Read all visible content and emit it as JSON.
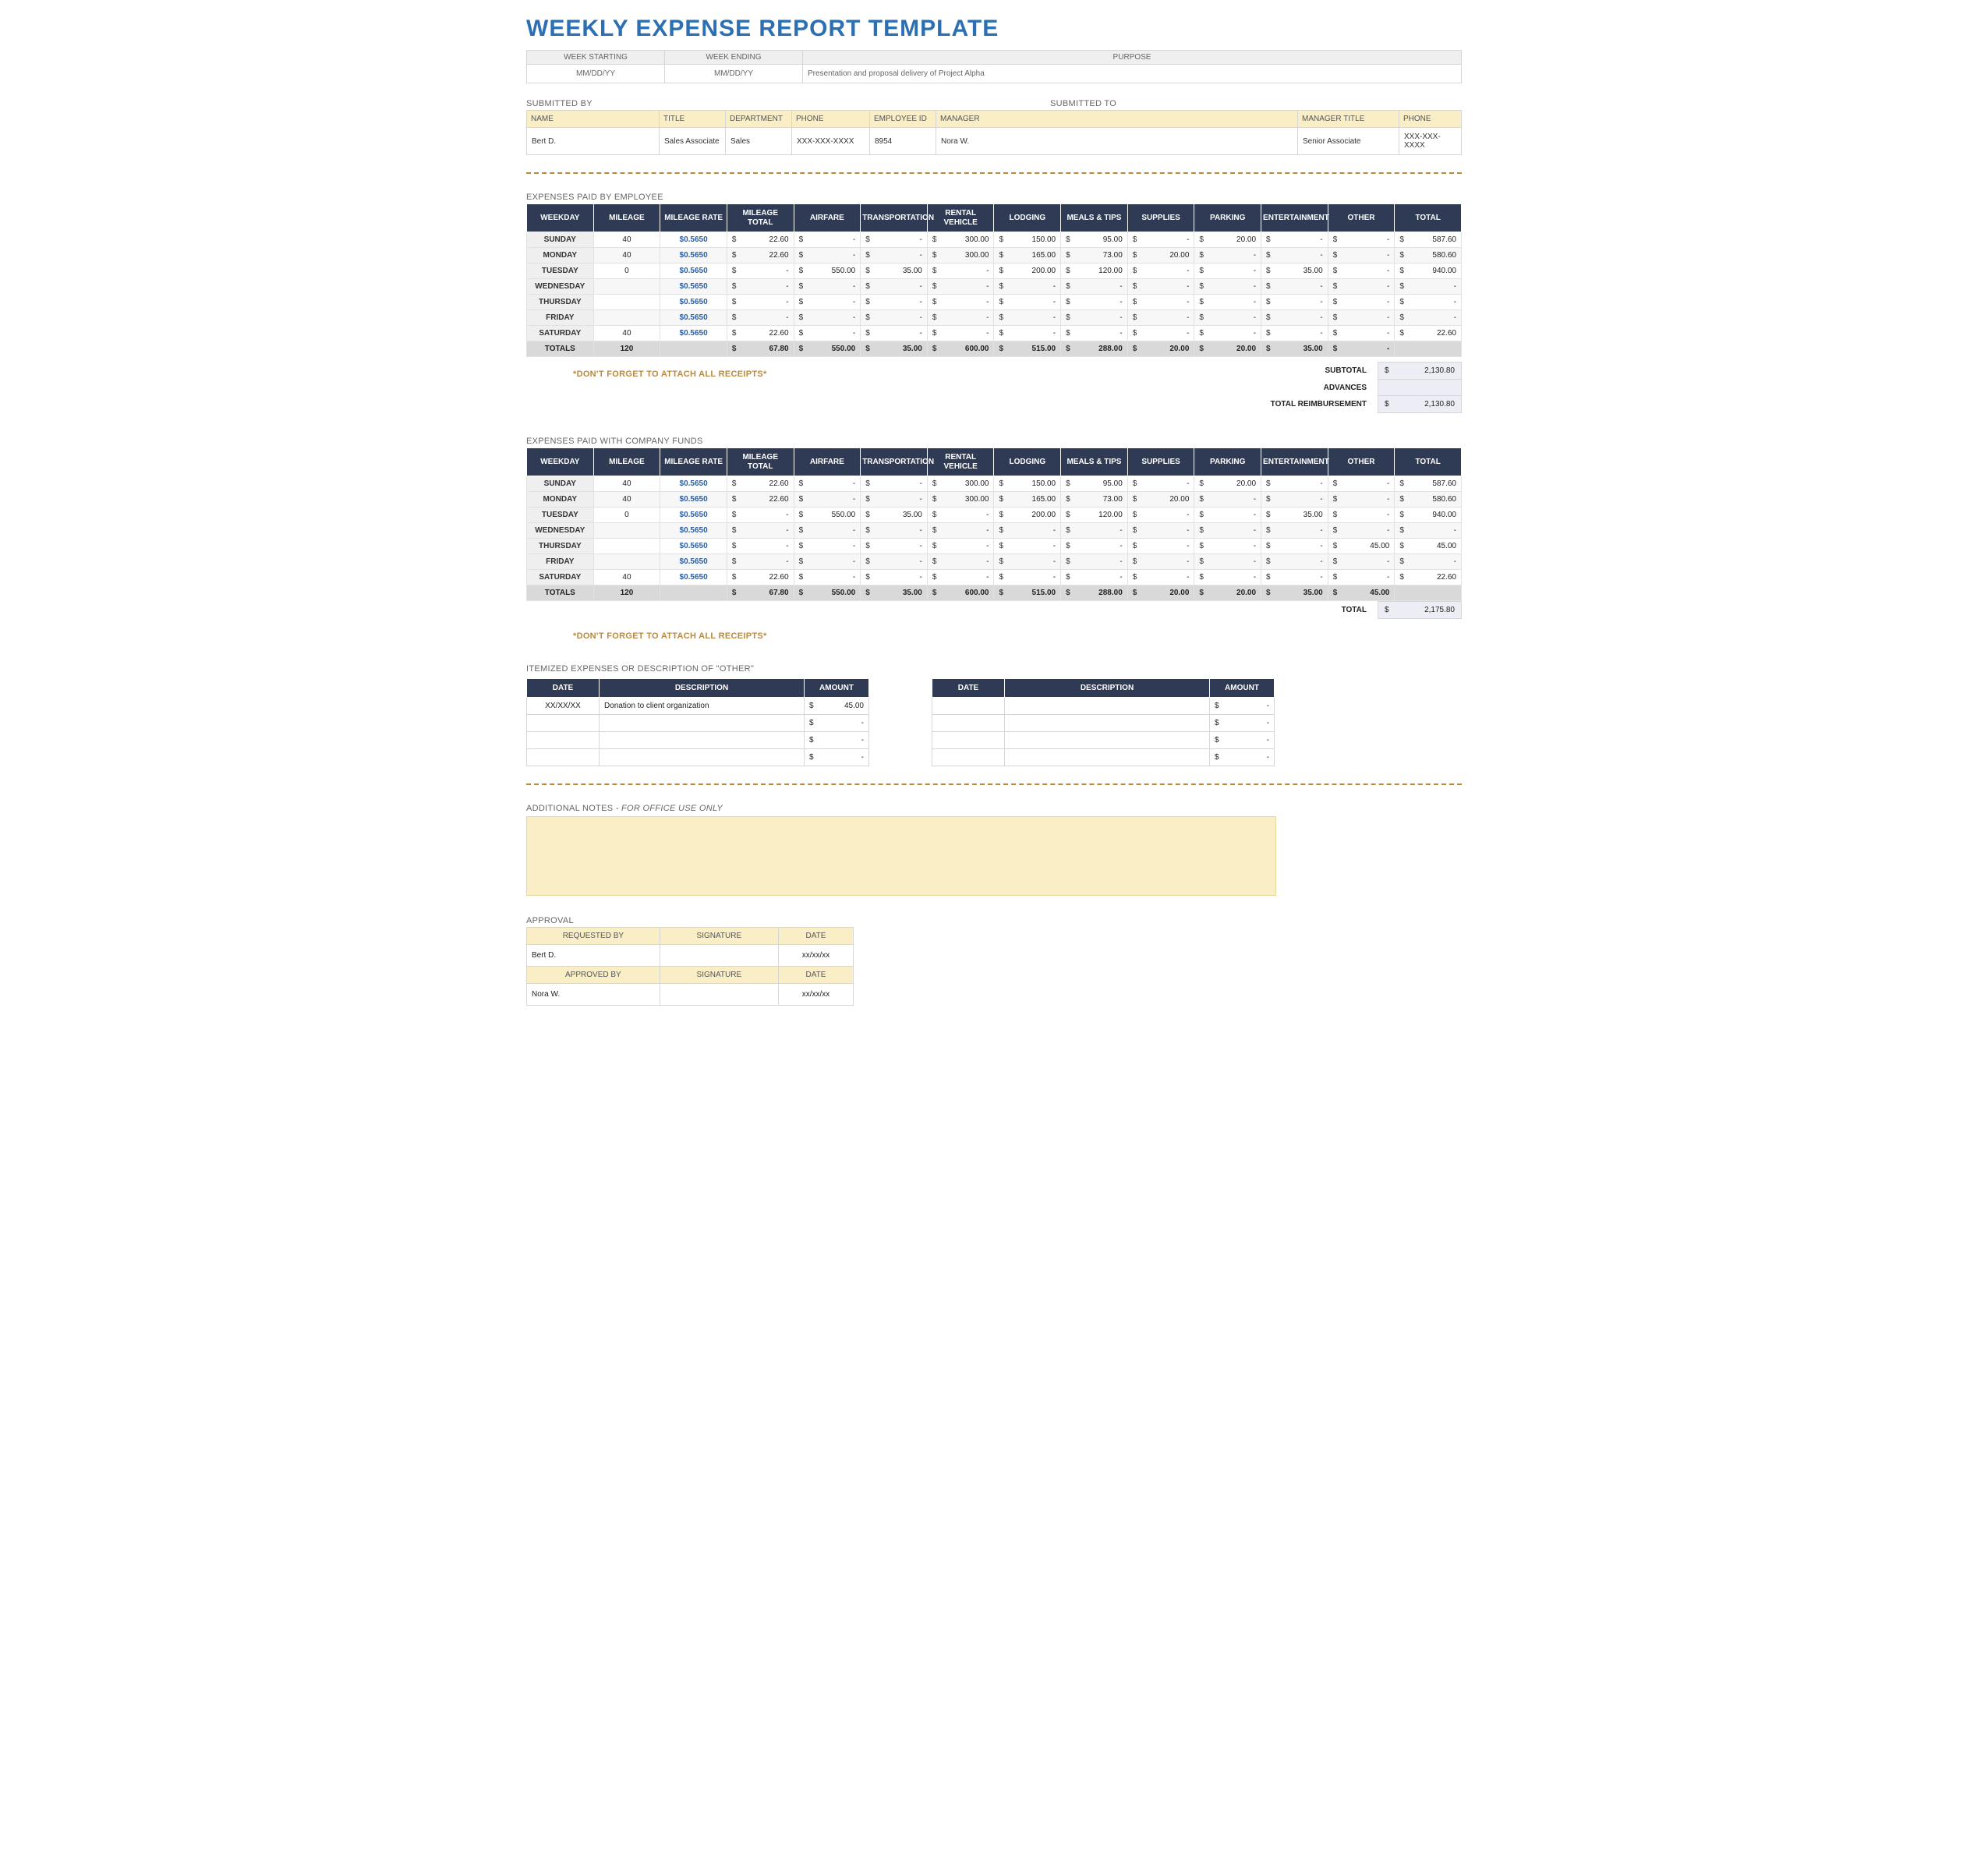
{
  "title": "WEEKLY EXPENSE REPORT TEMPLATE",
  "meta": {
    "headers": [
      "WEEK STARTING",
      "WEEK ENDING",
      "PURPOSE"
    ],
    "week_starting": "MM/DD/YY",
    "week_ending": "MM/DD/YY",
    "purpose": "Presentation and proposal delivery of Project Alpha"
  },
  "submitted_by": {
    "label": "SUBMITTED BY",
    "headers": [
      "NAME",
      "TITLE",
      "DEPARTMENT",
      "PHONE",
      "EMPLOYEE ID"
    ],
    "name": "Bert D.",
    "title": "Sales Associate",
    "department": "Sales",
    "phone": "XXX-XXX-XXXX",
    "employee_id": "8954"
  },
  "submitted_to": {
    "label": "SUBMITTED TO",
    "headers": [
      "MANAGER",
      "MANAGER TITLE",
      "PHONE"
    ],
    "manager": "Nora W.",
    "manager_title": "Senior Associate",
    "phone": "XXX-XXX-XXXX"
  },
  "exp_headers": [
    "WEEKDAY",
    "MILEAGE",
    "MILEAGE RATE",
    "MILEAGE TOTAL",
    "AIRFARE",
    "TRANSPORTATION",
    "RENTAL VEHICLE",
    "LODGING",
    "MEALS & TIPS",
    "SUPPLIES",
    "PARKING",
    "ENTERTAINMENT",
    "OTHER",
    "TOTAL"
  ],
  "section_employee": {
    "label": "EXPENSES PAID BY EMPLOYEE",
    "rows": [
      {
        "day": "SUNDAY",
        "mileage": "40",
        "rate": "$0.5650",
        "mtot": "22.60",
        "airfare": "-",
        "trans": "-",
        "rental": "300.00",
        "lodging": "150.00",
        "meals": "95.00",
        "supplies": "-",
        "parking": "20.00",
        "ent": "-",
        "other": "-",
        "total": "587.60"
      },
      {
        "day": "MONDAY",
        "mileage": "40",
        "rate": "$0.5650",
        "mtot": "22.60",
        "airfare": "-",
        "trans": "-",
        "rental": "300.00",
        "lodging": "165.00",
        "meals": "73.00",
        "supplies": "20.00",
        "parking": "-",
        "ent": "-",
        "other": "-",
        "total": "580.60"
      },
      {
        "day": "TUESDAY",
        "mileage": "0",
        "rate": "$0.5650",
        "mtot": "-",
        "airfare": "550.00",
        "trans": "35.00",
        "rental": "-",
        "lodging": "200.00",
        "meals": "120.00",
        "supplies": "-",
        "parking": "-",
        "ent": "35.00",
        "other": "-",
        "total": "940.00"
      },
      {
        "day": "WEDNESDAY",
        "mileage": "",
        "rate": "$0.5650",
        "mtot": "-",
        "airfare": "-",
        "trans": "-",
        "rental": "-",
        "lodging": "-",
        "meals": "-",
        "supplies": "-",
        "parking": "-",
        "ent": "-",
        "other": "-",
        "total": "-"
      },
      {
        "day": "THURSDAY",
        "mileage": "",
        "rate": "$0.5650",
        "mtot": "-",
        "airfare": "-",
        "trans": "-",
        "rental": "-",
        "lodging": "-",
        "meals": "-",
        "supplies": "-",
        "parking": "-",
        "ent": "-",
        "other": "-",
        "total": "-"
      },
      {
        "day": "FRIDAY",
        "mileage": "",
        "rate": "$0.5650",
        "mtot": "-",
        "airfare": "-",
        "trans": "-",
        "rental": "-",
        "lodging": "-",
        "meals": "-",
        "supplies": "-",
        "parking": "-",
        "ent": "-",
        "other": "-",
        "total": "-"
      },
      {
        "day": "SATURDAY",
        "mileage": "40",
        "rate": "$0.5650",
        "mtot": "22.60",
        "airfare": "-",
        "trans": "-",
        "rental": "-",
        "lodging": "-",
        "meals": "-",
        "supplies": "-",
        "parking": "-",
        "ent": "-",
        "other": "-",
        "total": "22.60"
      }
    ],
    "totals": {
      "day": "TOTALS",
      "mileage": "120",
      "rate": "",
      "mtot": "67.80",
      "airfare": "550.00",
      "trans": "35.00",
      "rental": "600.00",
      "lodging": "515.00",
      "meals": "288.00",
      "supplies": "20.00",
      "parking": "20.00",
      "ent": "35.00",
      "other": "-",
      "total": ""
    },
    "subtotal_label": "SUBTOTAL",
    "subtotal": "2,130.80",
    "advances_label": "ADVANCES",
    "advances": "",
    "reimb_label": "TOTAL REIMBURSEMENT",
    "reimb": "2,130.80"
  },
  "section_company": {
    "label": "EXPENSES PAID WITH COMPANY FUNDS",
    "rows": [
      {
        "day": "SUNDAY",
        "mileage": "40",
        "rate": "$0.5650",
        "mtot": "22.60",
        "airfare": "-",
        "trans": "-",
        "rental": "300.00",
        "lodging": "150.00",
        "meals": "95.00",
        "supplies": "-",
        "parking": "20.00",
        "ent": "-",
        "other": "-",
        "total": "587.60"
      },
      {
        "day": "MONDAY",
        "mileage": "40",
        "rate": "$0.5650",
        "mtot": "22.60",
        "airfare": "-",
        "trans": "-",
        "rental": "300.00",
        "lodging": "165.00",
        "meals": "73.00",
        "supplies": "20.00",
        "parking": "-",
        "ent": "-",
        "other": "-",
        "total": "580.60"
      },
      {
        "day": "TUESDAY",
        "mileage": "0",
        "rate": "$0.5650",
        "mtot": "-",
        "airfare": "550.00",
        "trans": "35.00",
        "rental": "-",
        "lodging": "200.00",
        "meals": "120.00",
        "supplies": "-",
        "parking": "-",
        "ent": "35.00",
        "other": "-",
        "total": "940.00"
      },
      {
        "day": "WEDNESDAY",
        "mileage": "",
        "rate": "$0.5650",
        "mtot": "-",
        "airfare": "-",
        "trans": "-",
        "rental": "-",
        "lodging": "-",
        "meals": "-",
        "supplies": "-",
        "parking": "-",
        "ent": "-",
        "other": "-",
        "total": "-"
      },
      {
        "day": "THURSDAY",
        "mileage": "",
        "rate": "$0.5650",
        "mtot": "-",
        "airfare": "-",
        "trans": "-",
        "rental": "-",
        "lodging": "-",
        "meals": "-",
        "supplies": "-",
        "parking": "-",
        "ent": "-",
        "other": "45.00",
        "total": "45.00"
      },
      {
        "day": "FRIDAY",
        "mileage": "",
        "rate": "$0.5650",
        "mtot": "-",
        "airfare": "-",
        "trans": "-",
        "rental": "-",
        "lodging": "-",
        "meals": "-",
        "supplies": "-",
        "parking": "-",
        "ent": "-",
        "other": "-",
        "total": "-"
      },
      {
        "day": "SATURDAY",
        "mileage": "40",
        "rate": "$0.5650",
        "mtot": "22.60",
        "airfare": "-",
        "trans": "-",
        "rental": "-",
        "lodging": "-",
        "meals": "-",
        "supplies": "-",
        "parking": "-",
        "ent": "-",
        "other": "-",
        "total": "22.60"
      }
    ],
    "totals": {
      "day": "TOTALS",
      "mileage": "120",
      "rate": "",
      "mtot": "67.80",
      "airfare": "550.00",
      "trans": "35.00",
      "rental": "600.00",
      "lodging": "515.00",
      "meals": "288.00",
      "supplies": "20.00",
      "parking": "20.00",
      "ent": "35.00",
      "other": "45.00",
      "total": ""
    },
    "total_label": "TOTAL",
    "total": "2,175.80"
  },
  "receipts_note": "*DON'T FORGET TO ATTACH ALL RECEIPTS*",
  "itemized": {
    "label": "ITEMIZED EXPENSES OR DESCRIPTION OF \"OTHER\"",
    "headers": [
      "DATE",
      "DESCRIPTION",
      "AMOUNT"
    ],
    "left": [
      {
        "date": "XX/XX/XX",
        "desc": "Donation to client organization",
        "amount": "45.00"
      },
      {
        "date": "",
        "desc": "",
        "amount": "-"
      },
      {
        "date": "",
        "desc": "",
        "amount": "-"
      },
      {
        "date": "",
        "desc": "",
        "amount": "-"
      }
    ],
    "right": [
      {
        "date": "",
        "desc": "",
        "amount": "-"
      },
      {
        "date": "",
        "desc": "",
        "amount": "-"
      },
      {
        "date": "",
        "desc": "",
        "amount": "-"
      },
      {
        "date": "",
        "desc": "",
        "amount": "-"
      }
    ]
  },
  "notes": {
    "label": "ADDITIONAL NOTES",
    "suffix": " - FOR OFFICE USE ONLY"
  },
  "approval": {
    "label": "APPROVAL",
    "headers1": [
      "REQUESTED BY",
      "SIGNATURE",
      "DATE"
    ],
    "req_name": "Bert D.",
    "req_date": "xx/xx/xx",
    "headers2": [
      "APPROVED BY",
      "SIGNATURE",
      "DATE"
    ],
    "appr_name": "Nora W.",
    "appr_date": "xx/xx/xx"
  }
}
